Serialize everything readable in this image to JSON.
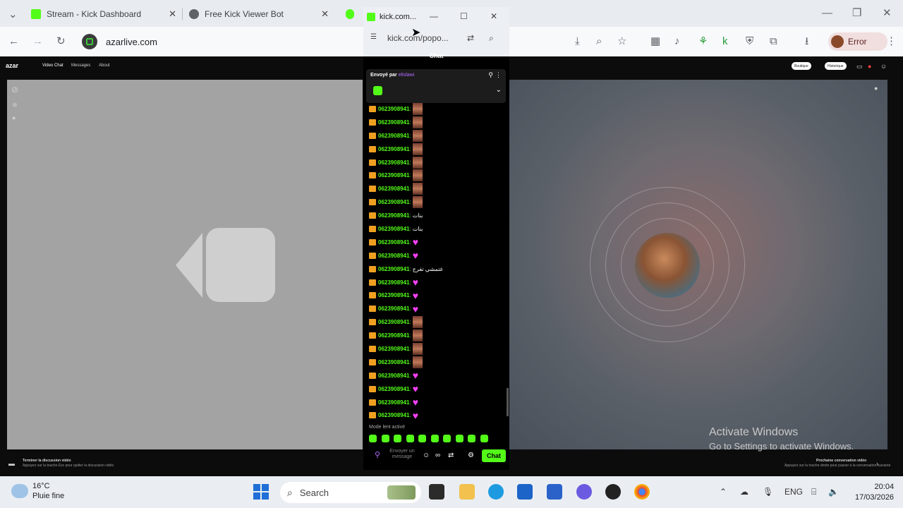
{
  "browser": {
    "tabs": [
      {
        "title": "Stream - Kick Dashboard",
        "icon": "kick-icon"
      },
      {
        "title": "Free Kick Viewer Bot",
        "icon": "globe-icon"
      }
    ],
    "url": "azarlive.com",
    "profile_status": "Error"
  },
  "azar": {
    "logo": "azar",
    "nav": [
      "Video Chat",
      "Messages",
      "About"
    ],
    "top_right": [
      "Boutique",
      "Historique"
    ],
    "bottom_left_line1": "Terminer la discussion vidéo",
    "bottom_left_line2": "Appuyez sur la touche Esc pour quitter la discussion vidéo",
    "bottom_right_line1": "Prochaine conversation vidéo",
    "bottom_right_line2": "Appuyez sur la touche droite pour passer à la conversation suivante"
  },
  "popup": {
    "window_title": "kick.com...",
    "address": "kick.com/popo...",
    "chat_title": "Chat",
    "pinned_label": "Envoyé par",
    "pinned_user": "elislawi",
    "messages": [
      {
        "user": "0623908941",
        "kind": "image",
        "text": ""
      },
      {
        "user": "0623908941",
        "kind": "image",
        "text": ""
      },
      {
        "user": "0623908941",
        "kind": "image",
        "text": ""
      },
      {
        "user": "0623908941",
        "kind": "image",
        "text": ""
      },
      {
        "user": "0623908941",
        "kind": "image",
        "text": ""
      },
      {
        "user": "0623908941",
        "kind": "image",
        "text": ""
      },
      {
        "user": "0623908941",
        "kind": "image",
        "text": ""
      },
      {
        "user": "0623908941",
        "kind": "image",
        "text": ""
      },
      {
        "user": "0623908941",
        "kind": "text",
        "text": "بنات"
      },
      {
        "user": "0623908941",
        "kind": "text",
        "text": "بنات"
      },
      {
        "user": "0623908941",
        "kind": "heart",
        "text": ""
      },
      {
        "user": "0623908941",
        "kind": "heart",
        "text": ""
      },
      {
        "user": "0623908941",
        "kind": "text",
        "text": "غتمشي تفرج"
      },
      {
        "user": "0623908941",
        "kind": "heart",
        "text": ""
      },
      {
        "user": "0623908941",
        "kind": "heart",
        "text": ""
      },
      {
        "user": "0623908941",
        "kind": "heart",
        "text": ""
      },
      {
        "user": "0623908941",
        "kind": "image",
        "text": ""
      },
      {
        "user": "0623908941",
        "kind": "image",
        "text": ""
      },
      {
        "user": "0623908941",
        "kind": "image",
        "text": ""
      },
      {
        "user": "0623908941",
        "kind": "image",
        "text": ""
      },
      {
        "user": "0623908941",
        "kind": "heart",
        "text": ""
      },
      {
        "user": "0623908941",
        "kind": "heart",
        "text": ""
      },
      {
        "user": "0623908941",
        "kind": "heart",
        "text": ""
      },
      {
        "user": "0623908941",
        "kind": "heart",
        "text": ""
      }
    ],
    "slow_mode": "Mode lent activé",
    "input_placeholder": "Envoyer un message",
    "send_label": "Chat"
  },
  "overlay": {
    "activate_title": "Activate Windows",
    "activate_sub": "Go to Settings to activate Windows."
  },
  "taskbar": {
    "temp": "16°C",
    "weather": "Pluie fine",
    "search_placeholder": "Search",
    "lang": "ENG",
    "time": "20:04",
    "date": "17/03/2026"
  },
  "colors": {
    "kick_green": "#53fc18",
    "user_purple": "#b06bff"
  }
}
